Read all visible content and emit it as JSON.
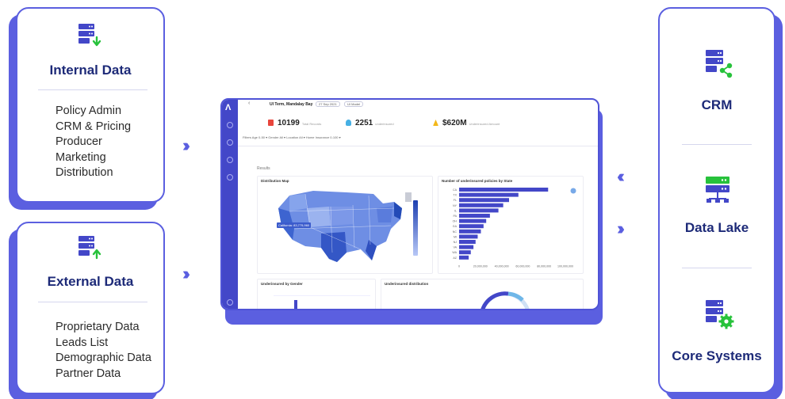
{
  "internal": {
    "title": "Internal Data",
    "items": [
      "Policy Admin",
      "CRM & Pricing",
      "Producer",
      "Marketing",
      "Distribution"
    ]
  },
  "external": {
    "title": "External Data",
    "items": [
      "Proprietary Data",
      "Leads List",
      "Demographic Data",
      "Partner Data"
    ]
  },
  "systems": {
    "crm": "CRM",
    "data_lake": "Data Lake",
    "core": "Core Systems"
  },
  "colors": {
    "accent": "#5b5fe0",
    "title": "#1d2a78",
    "icon_green": "#27c23b",
    "server": "#4347c8"
  },
  "dashboard": {
    "project": "UI Term, Mandalay Bay",
    "date": "27 Sep 2021",
    "model": "UI Model",
    "stats": [
      {
        "value": "10199",
        "sub": "Total Records"
      },
      {
        "value": "2251",
        "sub": "underinsured"
      },
      {
        "value": "$620M",
        "sub": "Underinsured Amount"
      }
    ],
    "filters": "Filters  Age  0-50 ▾   Gender  All ▾   Location  All ▾   Home Insurance  0-100 ▾",
    "results_label": "Results",
    "map_title": "Distribution Map",
    "map_tooltip": "California: 83,775,960",
    "bar_title": "Number of underinsured policies by State",
    "gender_title": "Underinsured by Gender",
    "dist_title": "Underinsured distribution"
  },
  "chart_data": {
    "type": "bar",
    "title": "Number of underinsured policies by State",
    "categories": [
      "CA",
      "TX",
      "FL",
      "NY",
      "IL",
      "PA",
      "OH",
      "GA",
      "NC",
      "MI",
      "NJ",
      "VA",
      "WA",
      "AZ"
    ],
    "values": [
      83775960,
      55800000,
      47000000,
      41500000,
      37000000,
      29000000,
      25500000,
      23000000,
      20500000,
      17500000,
      15500000,
      13500000,
      11000000,
      9000000
    ],
    "xlim": [
      0,
      100000000
    ],
    "x_ticks": [
      "0",
      "20,000,000",
      "40,000,000",
      "60,000,000",
      "80,000,000",
      "100,000,000"
    ]
  }
}
